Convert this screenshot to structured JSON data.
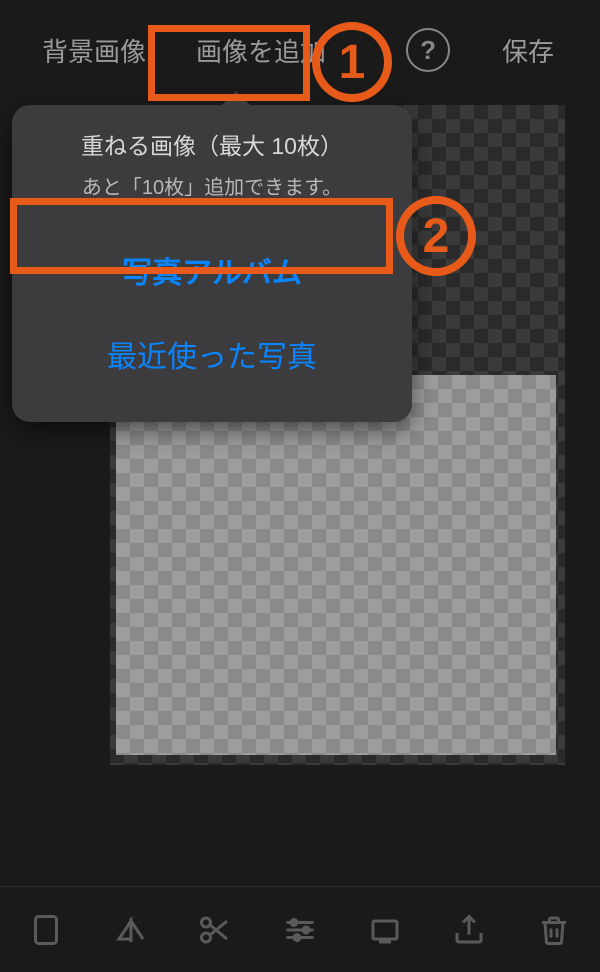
{
  "toolbar": {
    "background_image": "背景画像",
    "add_image": "画像を追加",
    "help": "?",
    "save": "保存"
  },
  "popover": {
    "title": "重ねる画像（最大 10枚）",
    "subtitle": "あと「10枚」追加できます。",
    "option_album": "写真アルバム",
    "option_recent": "最近使った写真"
  },
  "callouts": {
    "one": "1",
    "two": "2"
  },
  "bottom_tools": {
    "rotate": "rotate",
    "flip": "flip",
    "cut": "cut",
    "adjust": "adjust",
    "frame": "frame",
    "export": "export",
    "trash": "trash"
  }
}
